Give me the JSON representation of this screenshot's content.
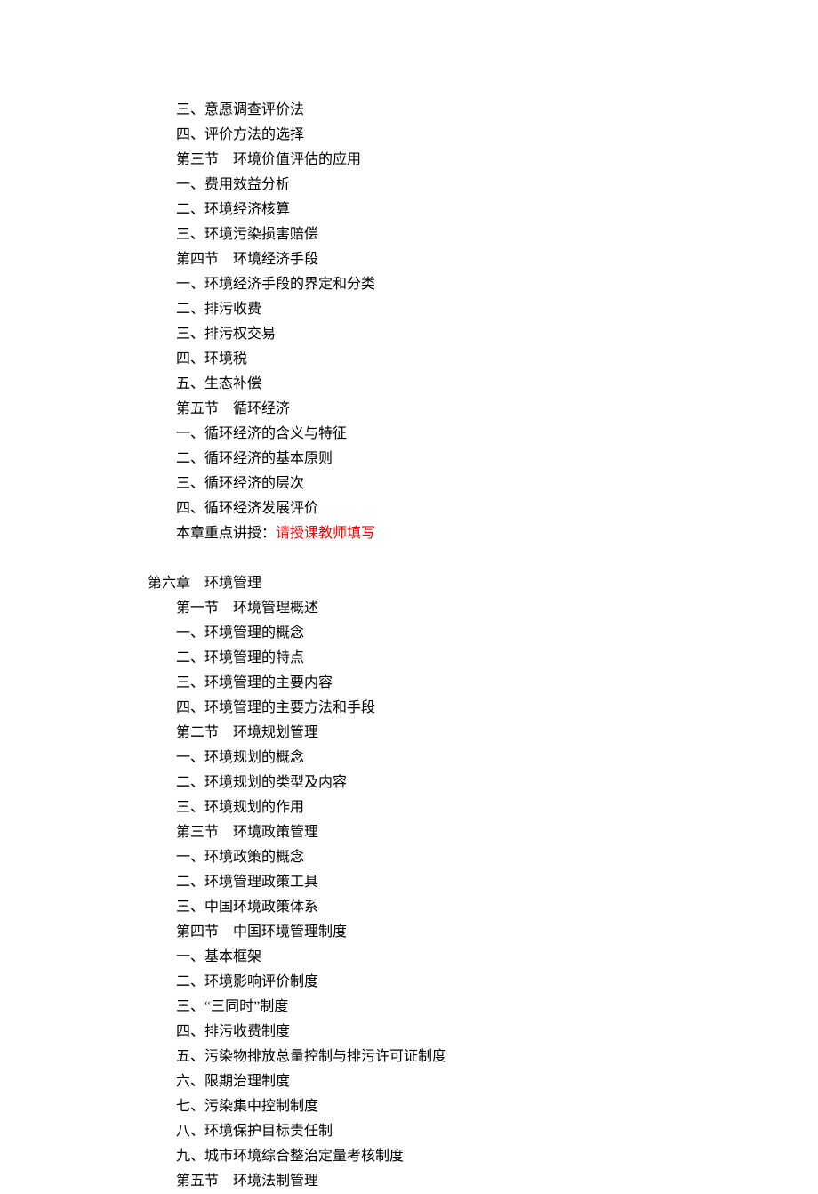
{
  "block1": {
    "items": [
      "三、意愿调查评价法",
      "四、评价方法的选择",
      "第三节　环境价值评估的应用",
      "一、费用效益分析",
      "二、环境经济核算",
      "三、环境污染损害赔偿",
      "第四节　环境经济手段",
      "一、环境经济手段的界定和分类",
      "二、排污收费",
      "三、排污权交易",
      "四、环境税",
      "五、生态补偿",
      "第五节　循环经济",
      "一、循环经济的含义与特征",
      "二、循环经济的基本原则",
      "三、循环经济的层次",
      "四、循环经济发展评价"
    ],
    "emphasis_prefix": "本章重点讲授：",
    "emphasis_red": "请授课教师填写"
  },
  "chapter6": {
    "title": "第六章　环境管理",
    "items": [
      "第一节　环境管理概述",
      "一、环境管理的概念",
      "二、环境管理的特点",
      "三、环境管理的主要内容",
      "四、环境管理的主要方法和手段",
      "第二节　环境规划管理",
      "一、环境规划的概念",
      "二、环境规划的类型及内容",
      "三、环境规划的作用",
      "第三节　环境政策管理",
      "一、环境政策的概念",
      "二、环境管理政策工具",
      "三、中国环境政策体系",
      "第四节　中国环境管理制度",
      "一、基本框架",
      "二、环境影响评价制度",
      "三、“三同时”制度",
      "四、排污收费制度",
      "五、污染物排放总量控制与排污许可证制度",
      "六、限期治理制度",
      "七、污染集中控制制度",
      "八、环境保护目标责任制",
      "九、城市环境综合整治定量考核制度",
      "第五节　环境法制管理"
    ]
  }
}
